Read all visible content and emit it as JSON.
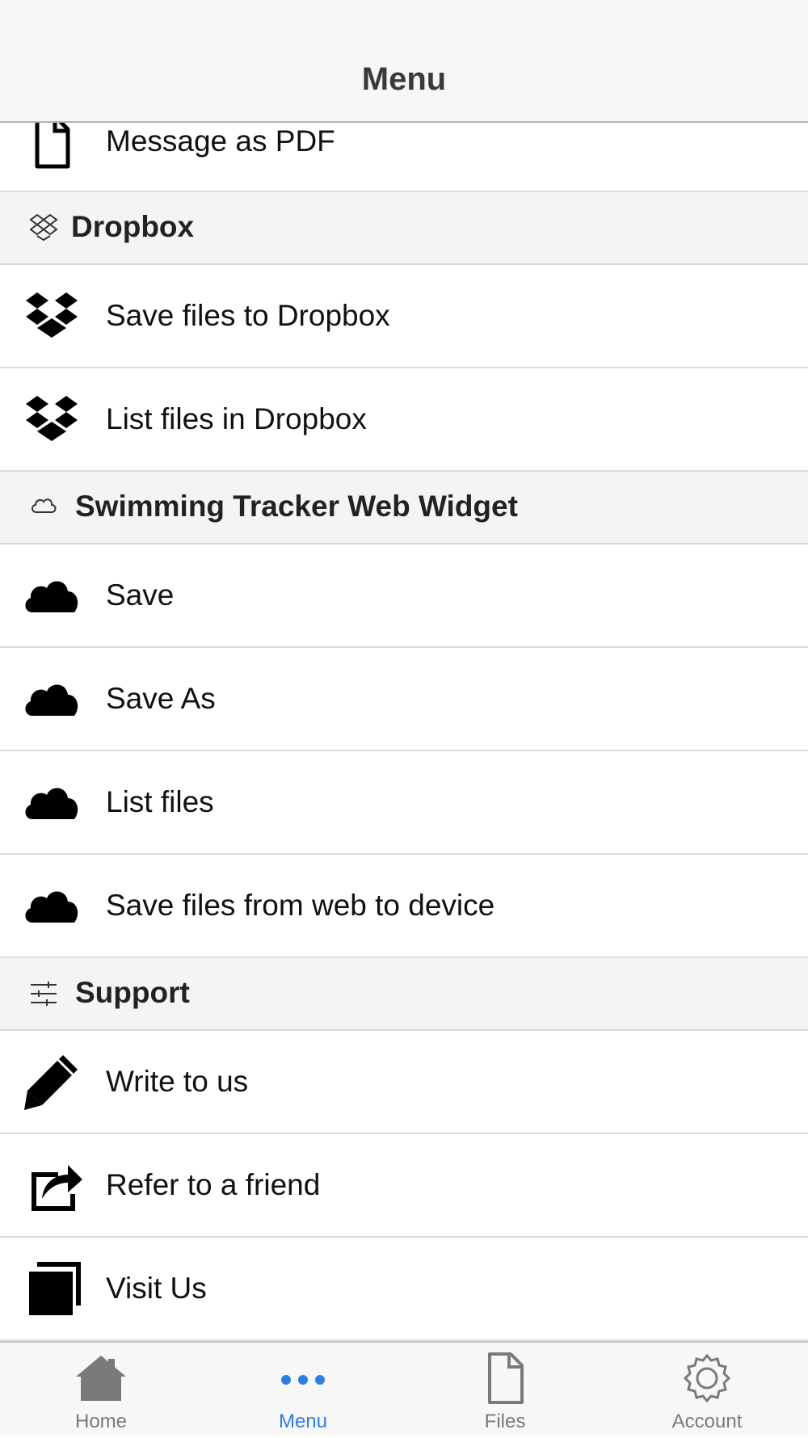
{
  "header": {
    "title": "Menu"
  },
  "rows": {
    "message_pdf": "Message as PDF",
    "save_dropbox": "Save files to Dropbox",
    "list_dropbox": "List files in Dropbox",
    "save": "Save",
    "save_as": "Save As",
    "list_files": "List files",
    "save_web": "Save files from web to device",
    "write_us": "Write to us",
    "refer": "Refer to a friend",
    "visit": "Visit Us"
  },
  "sections": {
    "dropbox": "Dropbox",
    "widget": "Swimming Tracker Web Widget",
    "support": "Support"
  },
  "tabbar": {
    "home": "Home",
    "menu": "Menu",
    "files": "Files",
    "account": "Account",
    "active": "Menu"
  },
  "colors": {
    "accent": "#2f7de1",
    "tab_inactive": "#7a7a7a",
    "section_bg": "#f4f4f4"
  }
}
